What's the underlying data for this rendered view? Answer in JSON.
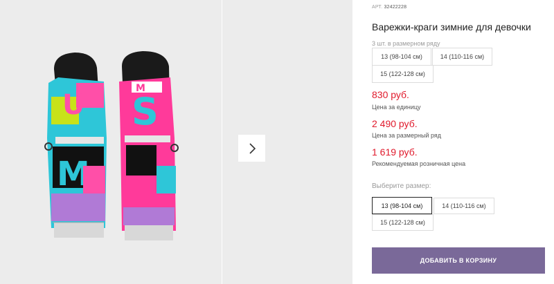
{
  "product": {
    "sku_label": "АРТ.",
    "sku_value": "32422228",
    "title": "Варежки-краги зимние для девочки"
  },
  "size_row": {
    "label": "3 шт. в размерном ряду",
    "sizes": [
      "13 (98-104 см)",
      "14 (110-116 см)",
      "15 (122-128 см)"
    ]
  },
  "prices": [
    {
      "amount": "830 руб.",
      "note": "Цена за единицу"
    },
    {
      "amount": "2 490 руб.",
      "note": "Цена за размерный ряд"
    },
    {
      "amount": "1 619 руб.",
      "note": "Рекомендуемая розничная цена"
    }
  ],
  "size_select": {
    "label": "Выберите размер:",
    "options": [
      "13 (98-104 см)",
      "14 (110-116 см)",
      "15 (122-128 см)"
    ],
    "selected": "13 (98-104 см)"
  },
  "cart_button": {
    "label": "ДОБАВИТЬ В КОРЗИНУ"
  },
  "gallery": {
    "next_icon": "chevron-right-icon"
  },
  "colors": {
    "accent": "#7a6999",
    "price": "#e0192b"
  }
}
